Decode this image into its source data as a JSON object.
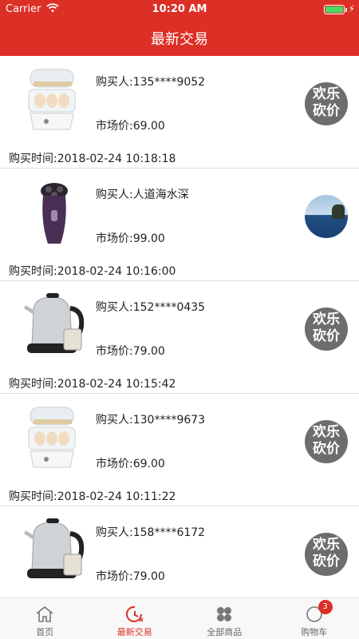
{
  "status": {
    "carrier": "Carrier",
    "time": "10:20 AM"
  },
  "header": {
    "title": "最新交易"
  },
  "badge_text": [
    "欢乐",
    "砍价"
  ],
  "items": [
    {
      "thumb": "egg-cooker",
      "buyer": "购买人:135****9052",
      "price": "市场价:69.00",
      "time": "购买时间:2018-02-24 10:18:18",
      "badge": "bargain"
    },
    {
      "thumb": "shaver",
      "buyer": "购买人:人道海水深",
      "price": "市场价:99.00",
      "time": "购买时间:2018-02-24 10:16:00",
      "badge": "avatar-photo"
    },
    {
      "thumb": "kettle",
      "buyer": "购买人:152****0435",
      "price": "市场价:79.00",
      "time": "购买时间:2018-02-24 10:15:42",
      "badge": "bargain"
    },
    {
      "thumb": "egg-cooker",
      "buyer": "购买人:130****9673",
      "price": "市场价:69.00",
      "time": "购买时间:2018-02-24 10:11:22",
      "badge": "bargain"
    },
    {
      "thumb": "kettle",
      "buyer": "购买人:158****6172",
      "price": "市场价:79.00",
      "time": "",
      "badge": "bargain"
    }
  ],
  "tabbar": {
    "tabs": [
      {
        "label": "首页",
        "icon": "home-icon"
      },
      {
        "label": "最新交易",
        "icon": "clock-refresh-icon"
      },
      {
        "label": "全部商品",
        "icon": "grid-icon"
      },
      {
        "label": "购物车",
        "icon": "compass-icon"
      }
    ],
    "cart_count": "3"
  },
  "colors": {
    "accent": "#dc2f26",
    "badge_gray": "#6d6d6d",
    "battery": "#4cd964"
  }
}
